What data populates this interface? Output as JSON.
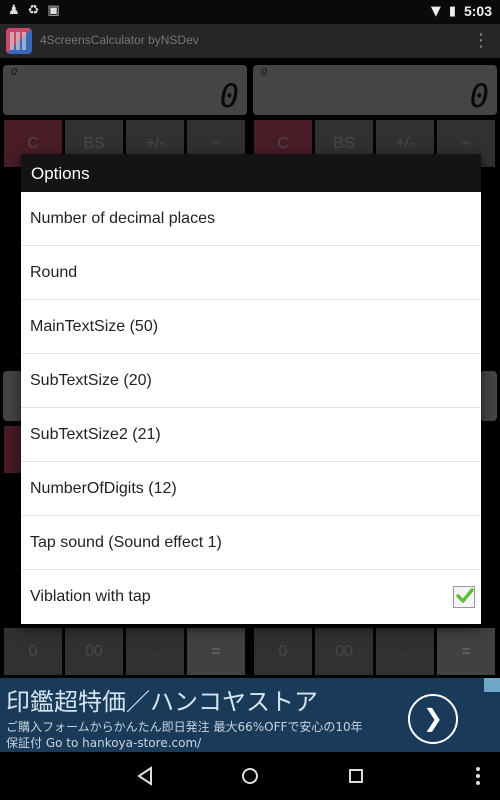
{
  "statusbar": {
    "time": "5:03"
  },
  "actionbar": {
    "title": "4ScreensCalculator byNSDev"
  },
  "calculator": {
    "display_left": {
      "mini": "0",
      "value": "0"
    },
    "display_right": {
      "mini": "0",
      "value": "0"
    },
    "top_keys": [
      "C",
      "BS",
      "+/-",
      "÷"
    ],
    "bottom_keys": [
      "0",
      "00",
      ".",
      "="
    ]
  },
  "dialog": {
    "title": "Options",
    "options": [
      {
        "label": "Number of decimal places"
      },
      {
        "label": "Round"
      },
      {
        "label": "MainTextSize (50)"
      },
      {
        "label": "SubTextSize (20)"
      },
      {
        "label": "SubTextSize2 (21)"
      },
      {
        "label": "NumberOfDigits (12)"
      },
      {
        "label": "Tap sound (Sound effect 1)"
      },
      {
        "label": "Viblation with tap",
        "checked": true
      }
    ]
  },
  "ad": {
    "headline": "印鑑超特価／ハンコヤストア",
    "line2": "ご購入フォームからかんたん即日発注 最大66%OFFで安心の10年",
    "line3": "保証付 Go to hankoya-store.com/"
  },
  "colors": {
    "dialog_title_bg": "#141414",
    "check_green": "#5fbf3a",
    "red_key": "#86344a"
  },
  "icons": {
    "nav_back": "back-triangle-icon",
    "nav_home": "home-circle-icon",
    "nav_recents": "recents-square-icon"
  }
}
